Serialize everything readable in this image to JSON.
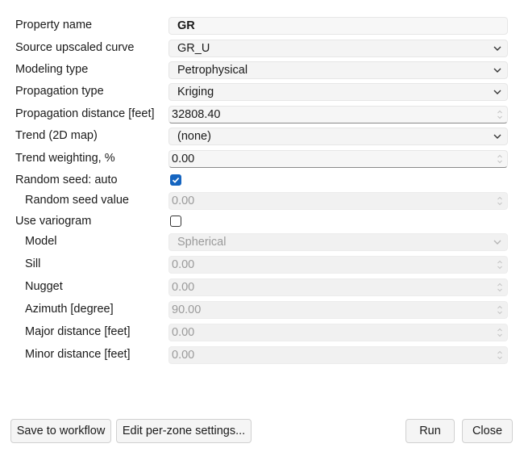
{
  "form": {
    "property_name": {
      "label": "Property name",
      "value": "GR"
    },
    "source_upscaled_curve": {
      "label": "Source upscaled curve",
      "value": "GR_U"
    },
    "modeling_type": {
      "label": "Modeling type",
      "value": "Petrophysical"
    },
    "propagation_type": {
      "label": "Propagation type",
      "value": "Kriging"
    },
    "propagation_distance": {
      "label": "Propagation distance [feet]",
      "value": "32808.40"
    },
    "trend": {
      "label": "Trend (2D map)",
      "value": "(none)"
    },
    "trend_weighting": {
      "label": "Trend weighting, %",
      "value": "0.00"
    },
    "random_seed_auto": {
      "label": "Random seed: auto",
      "checked": true
    },
    "random_seed_value": {
      "label": "Random seed value",
      "value": "0.00"
    },
    "use_variogram": {
      "label": "Use variogram",
      "checked": false
    },
    "model": {
      "label": "Model",
      "value": "Spherical"
    },
    "sill": {
      "label": "Sill",
      "value": "0.00"
    },
    "nugget": {
      "label": "Nugget",
      "value": "0.00"
    },
    "azimuth": {
      "label": "Azimuth [degree]",
      "value": "90.00"
    },
    "major_distance": {
      "label": "Major distance [feet]",
      "value": "0.00"
    },
    "minor_distance": {
      "label": "Minor distance [feet]",
      "value": "0.00"
    }
  },
  "buttons": {
    "save_to_workflow": "Save to workflow",
    "edit_per_zone": "Edit per-zone settings...",
    "run": "Run",
    "close": "Close"
  },
  "colors": {
    "checkbox_checked": "#1565c0",
    "disabled_text": "#9a9a9a"
  }
}
